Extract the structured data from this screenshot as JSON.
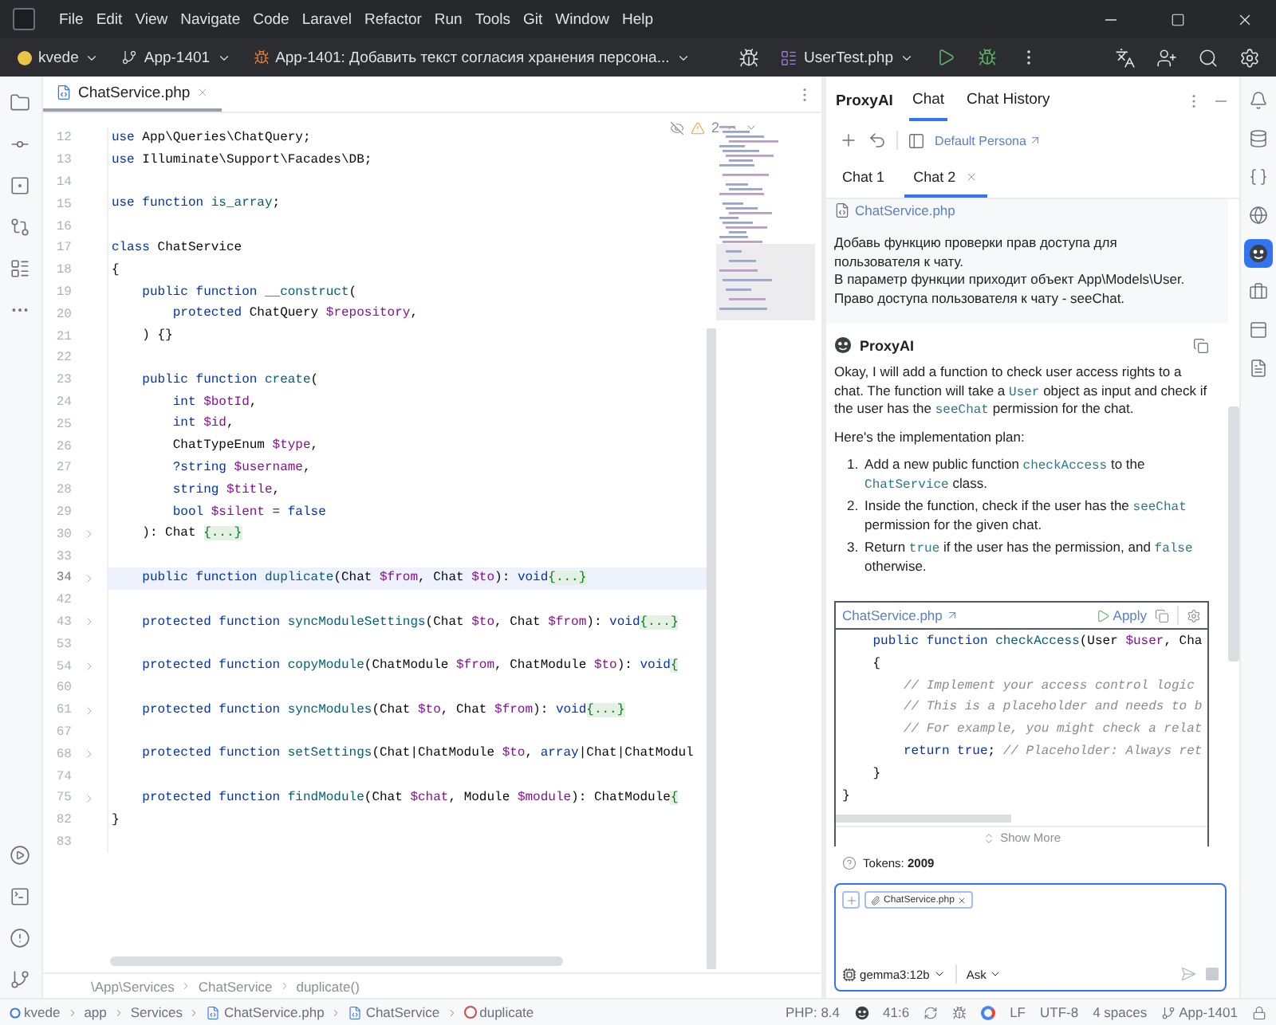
{
  "menu": [
    "File",
    "Edit",
    "View",
    "Navigate",
    "Code",
    "Laravel",
    "Refactor",
    "Run",
    "Tools",
    "Git",
    "Window",
    "Help"
  ],
  "toolbar": {
    "project": "kvede",
    "branch": "App-1401",
    "task": "App-1401: Добавить текст согласия хранения персона...",
    "run_config": "UserTest.php"
  },
  "editor": {
    "tabs": [
      {
        "label": "ChatService.php",
        "selected": true
      }
    ],
    "warnings": "2",
    "lines": [
      {
        "number": "12",
        "folded": false,
        "current": false,
        "tokens": [
          {
            "kind": "kw",
            "text": "use"
          },
          {
            "kind": "plain",
            "text": " App\\Queries\\ChatQuery;"
          }
        ]
      },
      {
        "number": "13",
        "folded": false,
        "current": false,
        "tokens": [
          {
            "kind": "kw",
            "text": "use"
          },
          {
            "kind": "plain",
            "text": " Illuminate\\Support\\Facades\\DB;"
          }
        ]
      },
      {
        "number": "14",
        "folded": false,
        "current": false
      },
      {
        "number": "15",
        "folded": false,
        "current": false,
        "tokens": [
          {
            "kind": "kw",
            "text": "use function"
          },
          {
            "kind": "fn",
            "text": " is_array"
          },
          {
            "kind": "plain",
            "text": ";"
          }
        ]
      },
      {
        "number": "16",
        "folded": false,
        "current": false
      },
      {
        "number": "17",
        "folded": false,
        "current": false,
        "tokens": [
          {
            "kind": "kw",
            "text": "class"
          },
          {
            "kind": "plain",
            "text": " ChatService"
          }
        ]
      },
      {
        "number": "18",
        "folded": false,
        "current": false,
        "tokens": [
          {
            "kind": "plain",
            "text": "{"
          }
        ]
      },
      {
        "number": "19",
        "folded": false,
        "current": false,
        "tokens": [
          {
            "kind": "kw",
            "text": "    public function"
          },
          {
            "kind": "fn",
            "text": " __construct"
          },
          {
            "kind": "plain",
            "text": "("
          }
        ]
      },
      {
        "number": "20",
        "folded": false,
        "current": false,
        "tokens": [
          {
            "kind": "kw",
            "text": "        protected"
          },
          {
            "kind": "plain",
            "text": " ChatQuery "
          },
          {
            "kind": "var",
            "text": "$repository"
          },
          {
            "kind": "plain",
            "text": ","
          }
        ]
      },
      {
        "number": "21",
        "folded": false,
        "current": false,
        "tokens": [
          {
            "kind": "plain",
            "text": "    ) {}"
          }
        ]
      },
      {
        "number": "22",
        "folded": false,
        "current": false
      },
      {
        "number": "23",
        "folded": false,
        "current": false,
        "tokens": [
          {
            "kind": "kw",
            "text": "    public function"
          },
          {
            "kind": "fn",
            "text": " create"
          },
          {
            "kind": "plain",
            "text": "("
          }
        ]
      },
      {
        "number": "24",
        "folded": false,
        "current": false,
        "tokens": [
          {
            "kind": "kw",
            "text": "        int"
          },
          {
            "kind": "var",
            "text": " $botId"
          },
          {
            "kind": "plain",
            "text": ","
          }
        ]
      },
      {
        "number": "25",
        "folded": false,
        "current": false,
        "tokens": [
          {
            "kind": "kw",
            "text": "        int"
          },
          {
            "kind": "var",
            "text": " $id"
          },
          {
            "kind": "plain",
            "text": ","
          }
        ]
      },
      {
        "number": "26",
        "folded": false,
        "current": false,
        "tokens": [
          {
            "kind": "plain",
            "text": "        ChatTypeEnum "
          },
          {
            "kind": "var",
            "text": "$type"
          },
          {
            "kind": "plain",
            "text": ","
          }
        ]
      },
      {
        "number": "27",
        "folded": false,
        "current": false,
        "tokens": [
          {
            "kind": "kw",
            "text": "        ?string"
          },
          {
            "kind": "var",
            "text": " $username"
          },
          {
            "kind": "plain",
            "text": ","
          }
        ]
      },
      {
        "number": "28",
        "folded": false,
        "current": false,
        "tokens": [
          {
            "kind": "kw",
            "text": "        string"
          },
          {
            "kind": "var",
            "text": " $title"
          },
          {
            "kind": "plain",
            "text": ","
          }
        ]
      },
      {
        "number": "29",
        "folded": false,
        "current": false,
        "tokens": [
          {
            "kind": "kw",
            "text": "        bool"
          },
          {
            "kind": "var",
            "text": " $silent"
          },
          {
            "kind": "plain",
            "text": " = "
          },
          {
            "kind": "kw",
            "text": "false"
          }
        ]
      },
      {
        "number": "30",
        "folded": true,
        "current": false,
        "tokens": [
          {
            "kind": "plain",
            "text": "    ): Chat "
          },
          {
            "kind": "fold",
            "text": "{...}"
          }
        ]
      },
      {
        "number": "33",
        "folded": false,
        "current": false
      },
      {
        "number": "34",
        "folded": true,
        "current": true,
        "tokens": [
          {
            "kind": "kw",
            "text": "    public function"
          },
          {
            "kind": "fn",
            "text": " duplicate"
          },
          {
            "kind": "plain",
            "text": "(Chat "
          },
          {
            "kind": "var",
            "text": "$from"
          },
          {
            "kind": "plain",
            "text": ", Chat "
          },
          {
            "kind": "var",
            "text": "$to"
          },
          {
            "kind": "plain",
            "text": "): "
          },
          {
            "kind": "kw",
            "text": "void"
          },
          {
            "kind": "fold",
            "text": "{...}"
          }
        ]
      },
      {
        "number": "42",
        "folded": false,
        "current": false
      },
      {
        "number": "43",
        "folded": true,
        "current": false,
        "tokens": [
          {
            "kind": "kw",
            "text": "    protected function"
          },
          {
            "kind": "fn",
            "text": " syncModuleSettings"
          },
          {
            "kind": "plain",
            "text": "(Chat "
          },
          {
            "kind": "var",
            "text": "$to"
          },
          {
            "kind": "plain",
            "text": ", Chat "
          },
          {
            "kind": "var",
            "text": "$from"
          },
          {
            "kind": "plain",
            "text": "): "
          },
          {
            "kind": "kw",
            "text": "void"
          },
          {
            "kind": "fold",
            "text": "{...}"
          }
        ]
      },
      {
        "number": "53",
        "folded": false,
        "current": false
      },
      {
        "number": "54",
        "folded": true,
        "current": false,
        "tokens": [
          {
            "kind": "kw",
            "text": "    protected function"
          },
          {
            "kind": "fn",
            "text": " copyModule"
          },
          {
            "kind": "plain",
            "text": "(ChatModule "
          },
          {
            "kind": "var",
            "text": "$from"
          },
          {
            "kind": "plain",
            "text": ", ChatModule "
          },
          {
            "kind": "var",
            "text": "$to"
          },
          {
            "kind": "plain",
            "text": "): "
          },
          {
            "kind": "kw",
            "text": "void"
          },
          {
            "kind": "fold",
            "text": "{"
          }
        ]
      },
      {
        "number": "60",
        "folded": false,
        "current": false
      },
      {
        "number": "61",
        "folded": true,
        "current": false,
        "tokens": [
          {
            "kind": "kw",
            "text": "    protected function"
          },
          {
            "kind": "fn",
            "text": " syncModules"
          },
          {
            "kind": "plain",
            "text": "(Chat "
          },
          {
            "kind": "var",
            "text": "$to"
          },
          {
            "kind": "plain",
            "text": ", Chat "
          },
          {
            "kind": "var",
            "text": "$from"
          },
          {
            "kind": "plain",
            "text": "): "
          },
          {
            "kind": "kw",
            "text": "void"
          },
          {
            "kind": "fold",
            "text": "{...}"
          }
        ]
      },
      {
        "number": "67",
        "folded": false,
        "current": false
      },
      {
        "number": "68",
        "folded": true,
        "current": false,
        "tokens": [
          {
            "kind": "kw",
            "text": "    protected function"
          },
          {
            "kind": "fn",
            "text": " setSettings"
          },
          {
            "kind": "plain",
            "text": "(Chat|ChatModule "
          },
          {
            "kind": "var",
            "text": "$to"
          },
          {
            "kind": "plain",
            "text": ", "
          },
          {
            "kind": "kw",
            "text": "array"
          },
          {
            "kind": "plain",
            "text": "|Chat|ChatModul"
          }
        ]
      },
      {
        "number": "74",
        "folded": false,
        "current": false
      },
      {
        "number": "75",
        "folded": true,
        "current": false,
        "tokens": [
          {
            "kind": "kw",
            "text": "    protected function"
          },
          {
            "kind": "fn",
            "text": " findModule"
          },
          {
            "kind": "plain",
            "text": "(Chat "
          },
          {
            "kind": "var",
            "text": "$chat"
          },
          {
            "kind": "plain",
            "text": ", Module "
          },
          {
            "kind": "var",
            "text": "$module"
          },
          {
            "kind": "plain",
            "text": "): ChatModule"
          },
          {
            "kind": "fold",
            "text": "{"
          }
        ]
      },
      {
        "number": "82",
        "folded": false,
        "current": false,
        "tokens": [
          {
            "kind": "plain",
            "text": "}"
          }
        ]
      },
      {
        "number": "83",
        "folded": false,
        "current": false
      }
    ],
    "breadcrumb": [
      "\\App\\Services",
      "ChatService",
      "duplicate()"
    ]
  },
  "chat_panel": {
    "title": "ProxyAI",
    "tabs": [
      {
        "label": "Chat",
        "selected": true
      },
      {
        "label": "Chat History",
        "selected": false
      }
    ],
    "persona_link": "Default Persona",
    "chat_tabs": [
      {
        "label": "Chat 1",
        "selected": false
      },
      {
        "label": "Chat 2",
        "selected": true
      }
    ],
    "user_message": {
      "file": "ChatService.php",
      "paragraphs": [
        "Добавь функцию проверки прав доступа для пользователя к чату.",
        "В параметр функции приходит объект App\\Models\\User.",
        "Право доступа пользователя к чату - seeChat."
      ]
    },
    "response": {
      "author": "ProxyAI",
      "paragraphs": [
        [
          {
            "code": false,
            "text": "Okay, I will add a function to check user access rights to a chat. The function will take a "
          },
          {
            "code": true,
            "text": "User"
          },
          {
            "code": false,
            "text": " object as input and check if the user has the "
          },
          {
            "code": true,
            "text": "seeChat"
          },
          {
            "code": false,
            "text": " permission for the chat."
          }
        ],
        [
          {
            "code": false,
            "text": "Here's the implementation plan:"
          }
        ]
      ],
      "plan": [
        {
          "number": "1.",
          "segments": [
            {
              "code": false,
              "text": "Add a new public function "
            },
            {
              "code": true,
              "text": "checkAccess"
            },
            {
              "code": false,
              "text": " to the "
            },
            {
              "code": true,
              "text": "ChatService"
            },
            {
              "code": false,
              "text": " class."
            }
          ]
        },
        {
          "number": "2.",
          "segments": [
            {
              "code": false,
              "text": "Inside the function, check if the user has the "
            },
            {
              "code": true,
              "text": "seeChat"
            },
            {
              "code": false,
              "text": " permission for the given chat."
            }
          ]
        },
        {
          "number": "3.",
          "segments": [
            {
              "code": false,
              "text": "Return "
            },
            {
              "code": true,
              "text": "true"
            },
            {
              "code": false,
              "text": " if the user has the permission, and "
            },
            {
              "code": true,
              "text": "false"
            },
            {
              "code": false,
              "text": " otherwise."
            }
          ]
        }
      ],
      "code_block": {
        "file": "ChatService.php",
        "apply": "Apply",
        "show_more": "Show More",
        "lines": [
          [
            {
              "kind": "kw",
              "text": "    public function"
            },
            {
              "kind": "fn",
              "text": " checkAccess"
            },
            {
              "kind": "plain",
              "text": "(User "
            },
            {
              "kind": "var",
              "text": "$user"
            },
            {
              "kind": "plain",
              "text": ", Cha"
            }
          ],
          [
            {
              "kind": "plain",
              "text": "    {"
            }
          ],
          [
            {
              "kind": "cm",
              "text": "        // Implement your access control logic"
            }
          ],
          [
            {
              "kind": "cm",
              "text": "        // This is a placeholder and needs to b"
            }
          ],
          [
            {
              "kind": "cm",
              "text": "        // For example, you might check a relat"
            }
          ],
          [
            {
              "kind": "kw",
              "text": "        return true"
            },
            {
              "kind": "plain",
              "text": "; "
            },
            {
              "kind": "cm",
              "text": "// Placeholder: Always ret"
            }
          ],
          [
            {
              "kind": "plain",
              "text": "    }"
            }
          ],
          [
            {
              "kind": "plain",
              "text": "}"
            }
          ]
        ]
      }
    },
    "tokens": "Tokens: **2009**",
    "input": {
      "attachments": [
        "ChatService.php"
      ],
      "model": "gemma3:12b",
      "mode": "Ask"
    }
  },
  "right_strip": [
    {
      "kind": "bell",
      "selected": false
    },
    {
      "kind": "database",
      "selected": false
    },
    {
      "kind": "braces",
      "selected": false
    },
    {
      "kind": "globe",
      "selected": false
    },
    {
      "kind": "proxyai",
      "selected": true
    },
    {
      "kind": "briefcase",
      "selected": false
    },
    {
      "kind": "panel",
      "selected": false
    },
    {
      "kind": "document",
      "selected": false
    }
  ],
  "status_bar": {
    "path": [
      {
        "kind": "module",
        "label": "kvede"
      },
      {
        "kind": "folder",
        "label": "app"
      },
      {
        "kind": "folder",
        "label": "Services"
      },
      {
        "kind": "class",
        "label": "ChatService.php"
      },
      {
        "kind": "class",
        "label": "ChatService"
      },
      {
        "kind": "method",
        "label": "duplicate"
      }
    ],
    "php": "PHP: 8.4",
    "position": "41:6",
    "line_separator": "LF",
    "encoding": "UTF-8",
    "indent": "4 spaces",
    "branch": "App-1401"
  }
}
